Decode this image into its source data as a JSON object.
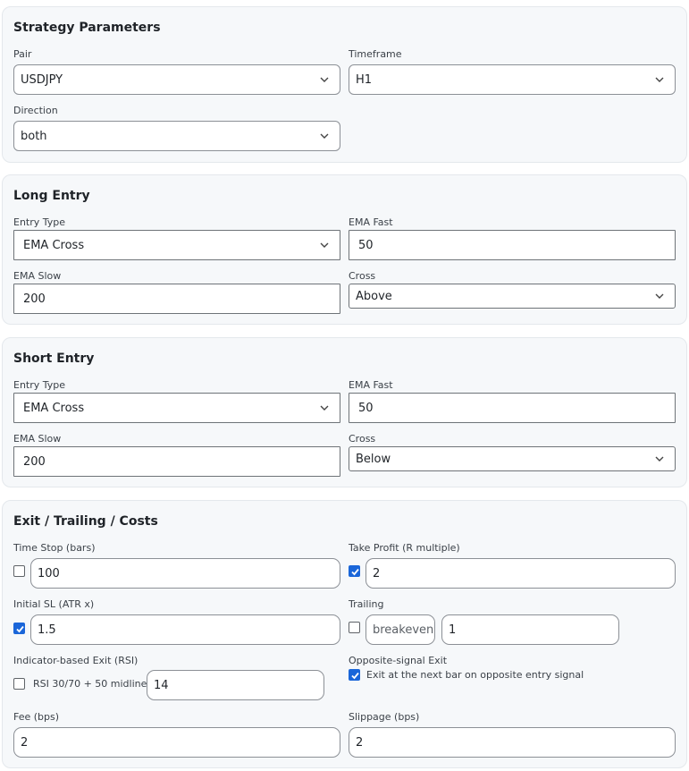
{
  "strategy": {
    "title": "Strategy Parameters",
    "pair_label": "Pair",
    "pair_value": "USDJPY",
    "timeframe_label": "Timeframe",
    "timeframe_value": "H1",
    "direction_label": "Direction",
    "direction_value": "both"
  },
  "long_entry": {
    "title": "Long Entry",
    "entry_type_label": "Entry Type",
    "entry_type_value": "EMA Cross",
    "ema_fast_label": "EMA Fast",
    "ema_fast_value": "50",
    "ema_slow_label": "EMA Slow",
    "ema_slow_value": "200",
    "cross_label": "Cross",
    "cross_value": "Above"
  },
  "short_entry": {
    "title": "Short Entry",
    "entry_type_label": "Entry Type",
    "entry_type_value": "EMA Cross",
    "ema_fast_label": "EMA Fast",
    "ema_fast_value": "50",
    "ema_slow_label": "EMA Slow",
    "ema_slow_value": "200",
    "cross_label": "Cross",
    "cross_value": "Below"
  },
  "exit": {
    "title": "Exit / Trailing / Costs",
    "time_stop_label": "Time Stop (bars)",
    "time_stop_checked": false,
    "time_stop_value": "100",
    "take_profit_label": "Take Profit (R multiple)",
    "take_profit_checked": true,
    "take_profit_value": "2",
    "initial_sl_label": "Initial SL (ATR x)",
    "initial_sl_checked": true,
    "initial_sl_value": "1.5",
    "trailing_label": "Trailing",
    "trailing_checked": false,
    "trailing_mode": "breakeven",
    "trailing_value": "1",
    "indicator_exit_label": "Indicator-based Exit (RSI)",
    "indicator_exit_checked": false,
    "indicator_exit_option": "RSI 30/70 + 50 midline",
    "indicator_exit_value": "14",
    "opposite_exit_label": "Opposite-signal Exit",
    "opposite_exit_checked": true,
    "opposite_exit_option": "Exit at the next bar on opposite entry signal",
    "fee_label": "Fee (bps)",
    "fee_value": "2",
    "slippage_label": "Slippage (bps)",
    "slippage_value": "2"
  },
  "colors": {
    "accent": "#1a66d9",
    "panel_bg": "#f6f8fa"
  }
}
